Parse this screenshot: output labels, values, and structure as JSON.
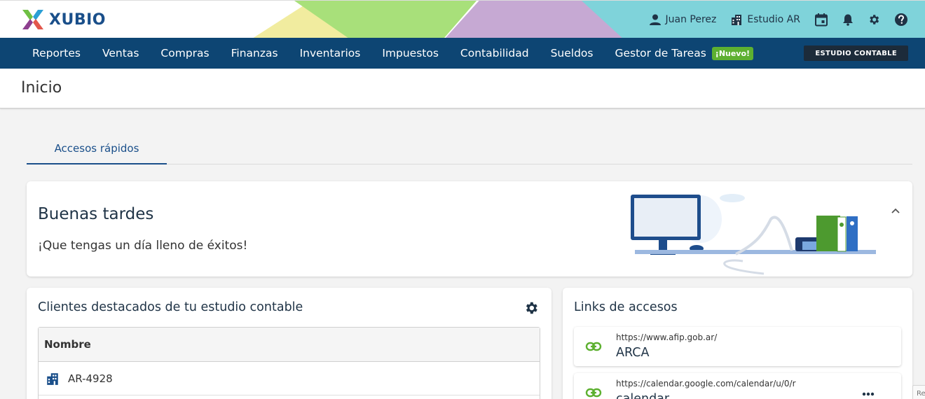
{
  "app": {
    "brand": "XUBIO"
  },
  "header": {
    "user_name": "Juan Perez",
    "studio_name": "Estudio AR"
  },
  "nav": {
    "items": [
      {
        "label": "Reportes"
      },
      {
        "label": "Ventas"
      },
      {
        "label": "Compras"
      },
      {
        "label": "Finanzas"
      },
      {
        "label": "Inventarios"
      },
      {
        "label": "Impuestos"
      },
      {
        "label": "Contabilidad"
      },
      {
        "label": "Sueldos"
      },
      {
        "label": "Gestor de Tareas",
        "badge": "¡Nuevo!"
      }
    ],
    "studio_button": "ESTUDIO CONTABLE"
  },
  "page": {
    "title": "Inicio"
  },
  "tabs": [
    {
      "label": "Accesos rápidos",
      "active": true
    }
  ],
  "greeting": {
    "title": "Buenas tardes",
    "subtitle": "¡Que tengas un día lleno de éxitos!"
  },
  "clients": {
    "title": "Clientes destacados de tu estudio contable",
    "column_header": "Nombre",
    "rows": [
      {
        "name": "AR-4928"
      }
    ]
  },
  "links": {
    "title": "Links de accesos",
    "items": [
      {
        "url": "https://www.afip.gob.ar/",
        "name": "ARCA"
      },
      {
        "url": "https://calendar.google.com/calendar/u/0/r",
        "name": "calendar"
      }
    ]
  },
  "recaptcha": {
    "label": "Re"
  },
  "colors": {
    "navbar": "#0d4573",
    "brand_blue": "#1a4f8a",
    "badge_green": "#5db030",
    "link_green": "#5db030"
  }
}
